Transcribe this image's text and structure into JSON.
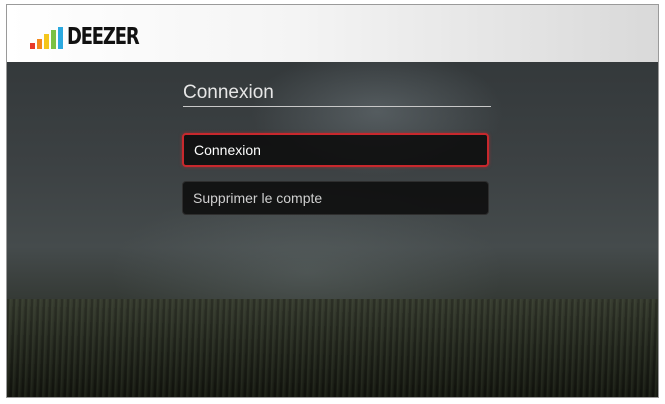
{
  "app": {
    "logo_text": "DEEZER",
    "logo_bar_colors": [
      "#e8392a",
      "#f28a1e",
      "#f4c61c",
      "#7ac143",
      "#2ba9e0"
    ]
  },
  "screen": {
    "title": "Connexion"
  },
  "menu": {
    "items": [
      {
        "label": "Connexion",
        "selected": true
      },
      {
        "label": "Supprimer le compte",
        "selected": false
      }
    ]
  },
  "colors": {
    "focus_border": "#c8282d"
  }
}
